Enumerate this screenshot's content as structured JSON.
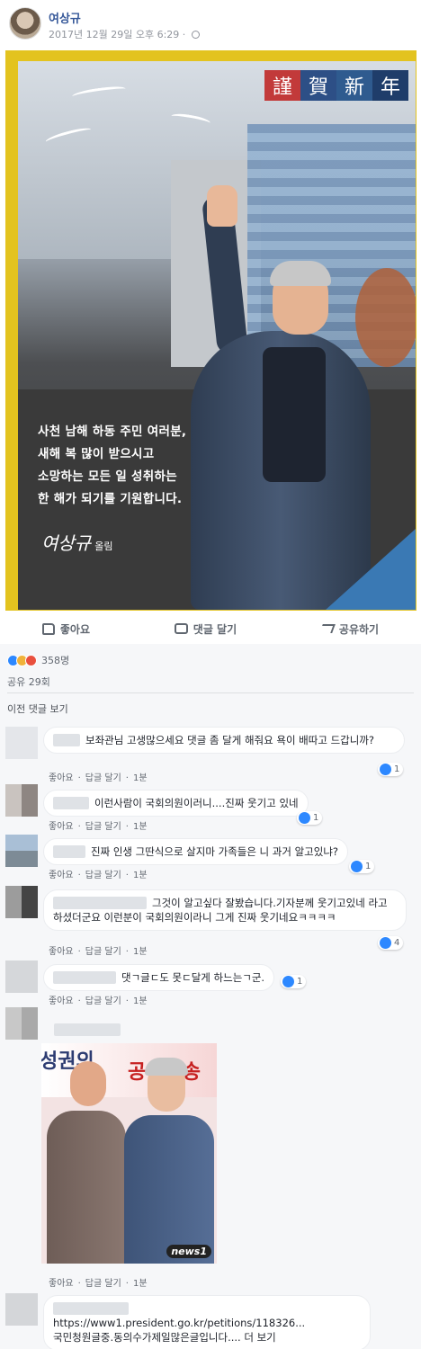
{
  "post": {
    "author": "여상규",
    "date": "2017년 12월 29일 오후 6:29 · "
  },
  "card": {
    "banner": [
      "謹",
      "賀",
      "新",
      "年"
    ],
    "message": [
      "사천 남해 하동 주민 여러분,",
      "새해 복 많이 받으시고",
      "소망하는 모든 일 성취하는",
      "한 해가 되기를 기원합니다."
    ],
    "signature": "여상규",
    "signature_suffix": "올림"
  },
  "actions": {
    "like": "좋아요",
    "comment": "댓글 달기",
    "share": "공유하기"
  },
  "reactions": {
    "count": "358명",
    "colors": [
      "#2d88ff",
      "#f0b23a",
      "#e9503e"
    ]
  },
  "shares": "공유 29회",
  "prev_comments": "이전 댓글 보기",
  "comment_actions": {
    "like": "좋아요",
    "reply": "답글 달기",
    "time": "1분"
  },
  "comments": [
    {
      "text": "보좌관님 고생많으세요 댓글 좀 달게 해줘요 욕이 배따고 드갑니까?",
      "likes": "1"
    },
    {
      "text": "이런사람이 국회의원이러니....진짜 웃기고 있네",
      "likes": "1"
    },
    {
      "text": "진짜 인생 그딴식으로 살지마 가족들은 니 과거 알고있냐?",
      "likes": "1"
    },
    {
      "text": "그것이 알고싶다 잘봤습니다.기자분께 웃기고있네 라고 하셨더군요 이런분이 국회의원이라니 그게 진짜 웃기네요ㅋㅋㅋㅋ",
      "likes": "4"
    },
    {
      "text": "댓ㄱ글ㄷ도 못ㄷ달게 하느는ㄱ군.",
      "likes": "1"
    },
    {
      "text": "",
      "likes": ""
    },
    {
      "text": "https://www1.president.go.kr/petitions/118326...",
      "text2": "국민청원글중.동의수가제일많은글입니다.... 더 보기",
      "likes": ""
    }
  ],
  "photo": {
    "text_left": "성권의",
    "text_right": "공영방송",
    "logo": "news1"
  }
}
